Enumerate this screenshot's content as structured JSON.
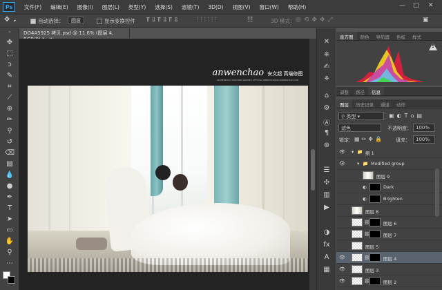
{
  "app": {
    "logo": "Ps"
  },
  "menu": [
    "文件(F)",
    "编辑(E)",
    "图像(I)",
    "图层(L)",
    "类型(Y)",
    "选择(S)",
    "滤镜(T)",
    "3D(D)",
    "视图(V)",
    "窗口(W)",
    "帮助(H)"
  ],
  "window_controls": {
    "minimize": "—",
    "maximize": "□",
    "close": "✕"
  },
  "options": {
    "auto_select_label": "自动选择：",
    "auto_select_value": "图层",
    "show_transform": "显示变换控件",
    "mode_3d": "3D 模式："
  },
  "document": {
    "tab_title": "DO4A5925 拷贝.psd @ 11.6% (图层 4, RGB/8) *"
  },
  "watermark": {
    "brand": "anwenchao",
    "cn": "安文超 高端修图",
    "tagline": "AN WENCHAO HIGH-END GRAPHIC OFFICIAL WEBSITE:WWW.ANWENCHAO.COM"
  },
  "histogram_panel": {
    "tabs": [
      "直方图",
      "颜色",
      "导航器",
      "色板",
      "样式"
    ],
    "warning": "!"
  },
  "adjust_panel": {
    "tabs": [
      "调整",
      "路径",
      "信息"
    ]
  },
  "layers_panel": {
    "tabs": [
      "图层",
      "历史记录",
      "通道",
      "动作"
    ],
    "filter": "类型",
    "blend": "滤色",
    "opacity_label": "不透明度：",
    "opacity": "100%",
    "lock_label": "锁定：",
    "fill_label": "填充：",
    "fill": "100%",
    "layers": [
      {
        "name": "组 1",
        "visible": true,
        "indent": 1,
        "kind": "group"
      },
      {
        "name": "Modified group",
        "visible": true,
        "indent": 2,
        "kind": "group"
      },
      {
        "name": "图层 9",
        "visible": false,
        "indent": 3,
        "kind": "photo"
      },
      {
        "name": "Dark",
        "visible": false,
        "indent": 3,
        "kind": "adj"
      },
      {
        "name": "Brighten",
        "visible": false,
        "indent": 3,
        "kind": "adj"
      },
      {
        "name": "图层 8",
        "visible": false,
        "indent": 1,
        "kind": "photo"
      },
      {
        "name": "图层 6",
        "visible": false,
        "indent": 1,
        "kind": "masked"
      },
      {
        "name": "图层 7",
        "visible": false,
        "indent": 1,
        "kind": "masked"
      },
      {
        "name": "图层 5",
        "visible": false,
        "indent": 1,
        "kind": "trans"
      },
      {
        "name": "图层 4",
        "visible": true,
        "indent": 1,
        "kind": "masked",
        "selected": true
      },
      {
        "name": "图层 3",
        "visible": true,
        "indent": 1,
        "kind": "trans"
      },
      {
        "name": "图层 2",
        "visible": true,
        "indent": 1,
        "kind": "masked"
      }
    ]
  }
}
